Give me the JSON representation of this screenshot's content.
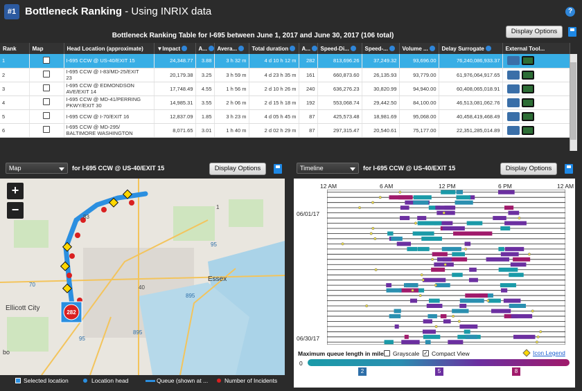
{
  "app": {
    "badge": "#1",
    "title_bold": "Bottleneck Ranking",
    "title_rest": " - Using INRIX data",
    "help": "?"
  },
  "table": {
    "title": "Bottleneck Ranking Table for I-695 between June 1, 2017 and June 30, 2017 (106 total)",
    "display_options": "Display Options",
    "columns": [
      "Rank",
      "Map",
      "Head Location (approximate)",
      "▼Impact",
      "A...",
      "Avera...",
      "Total duration",
      "A...",
      "Speed-Di...",
      "Speed-...",
      "Volume ...",
      "Delay Surrogate",
      "External Tool..."
    ],
    "rows": [
      {
        "rank": "1",
        "loc1": "I-695 CCW @ US-40/EXIT 15",
        "loc2": "",
        "impact": "24,348.77",
        "a1": "3.88",
        "avg": "3 h 32 m",
        "total": "4 d 10 h 12 m",
        "a2": "282",
        "sd": "813,696.26",
        "sp": "37,249.32",
        "vol": "93,696.00",
        "delay": "76,240,086,933.37"
      },
      {
        "rank": "2",
        "loc1": "I-695 CCW @ I-83/MD-25/EXIT",
        "loc2": "23",
        "impact": "20,179.38",
        "a1": "3.25",
        "avg": "3 h 59 m",
        "total": "4 d 23 h 35 m",
        "a2": "161",
        "sd": "660,873.60",
        "sp": "26,135.93",
        "vol": "93,779.00",
        "delay": "61,976,064,917.65"
      },
      {
        "rank": "3",
        "loc1": "I-695 CCW @ EDMONDSON",
        "loc2": "AVE/EXIT 14",
        "impact": "17,748.49",
        "a1": "4.55",
        "avg": "1 h 56 m",
        "total": "2 d 10 h 26 m",
        "a2": "240",
        "sd": "636,276.23",
        "sp": "30,820.99",
        "vol": "94,940.00",
        "delay": "60,408,065,018.91"
      },
      {
        "rank": "4",
        "loc1": "I-695 CCW @ MD-41/PERRING",
        "loc2": "PKWY/EXIT 30",
        "impact": "14,985.31",
        "a1": "3.55",
        "avg": "2 h 06 m",
        "total": "2 d 15 h 18 m",
        "a2": "192",
        "sd": "553,068.74",
        "sp": "29,442.50",
        "vol": "84,100.00",
        "delay": "46,513,081,062.76"
      },
      {
        "rank": "5",
        "loc1": "I-695 CCW @ I-70/EXIT 16",
        "loc2": "",
        "impact": "12,837.09",
        "a1": "1.85",
        "avg": "3 h 23 m",
        "total": "4 d 05 h 45 m",
        "a2": "87",
        "sd": "425,573.48",
        "sp": "18,981.69",
        "vol": "95,068.00",
        "delay": "40,458,419,468.49"
      },
      {
        "rank": "6",
        "loc1": "I-695 CCW @ MD-295/",
        "loc2": "BALTIMORE WASHINGTON",
        "impact": "8,071.65",
        "a1": "3.01",
        "avg": "1 h 40 m",
        "total": "2 d 02 h 29 m",
        "a2": "87",
        "sd": "297,315.47",
        "sp": "20,540.61",
        "vol": "75,177.00",
        "delay": "22,351,285,014.89"
      }
    ]
  },
  "map_panel": {
    "selector": "Map",
    "location": "for I-695 CCW @ US-40/EXIT 15",
    "display_options": "Display Options",
    "zoom_in": "+",
    "zoom_out": "−",
    "labels": {
      "essex": "Essex",
      "ellicott": "Ellicott City",
      "bo": "bo",
      "r70": "70",
      "r95": "95",
      "r895": "895",
      "r1": "1",
      "r83": "83",
      "r40": "40",
      "r895b": "895",
      "r95b": "95"
    },
    "marker_count": "282",
    "legend": {
      "selected": "Selected location",
      "head": "Location head",
      "queue": "Queue (shown at ...",
      "incidents": "Number of Incidents"
    }
  },
  "timeline_panel": {
    "selector": "Timeline",
    "location": "for I-695 CCW @ US-40/EXIT 15",
    "display_options": "Display Options",
    "x_ticks": [
      "12 AM",
      "6 AM",
      "12 PM",
      "6 PM",
      "12 AM"
    ],
    "date_start": "06/01/17",
    "date_end": "06/30/17",
    "queue_label": "Maximum queue length in miles",
    "grayscale": "Grayscale",
    "compact": "Compact View",
    "icon_legend": "Icon Legend",
    "scale_zero": "0",
    "scale_marks": [
      "2",
      "5",
      "8"
    ]
  },
  "colors": {
    "accent_blue": "#2f86d9",
    "selected_row": "#38aee5",
    "queue_teal": "#1a9aa8",
    "queue_purple": "#6b2fa0",
    "queue_magenta": "#a01a6b",
    "route_blue": "#2b8fe0"
  }
}
